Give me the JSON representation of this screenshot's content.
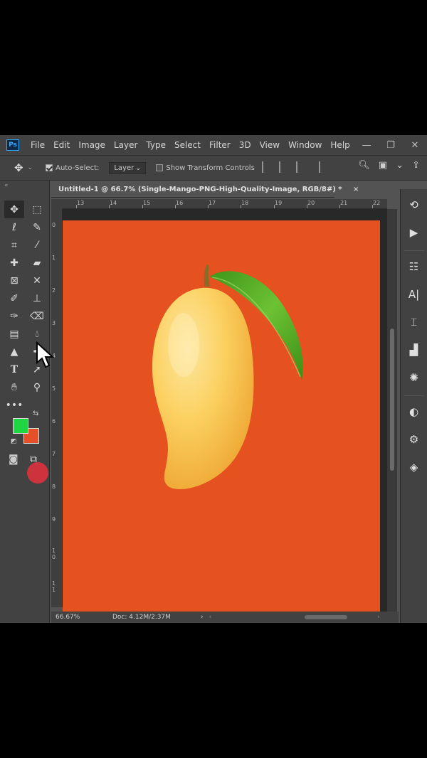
{
  "menu": {
    "logo": "Ps",
    "items": [
      "File",
      "Edit",
      "Image",
      "Layer",
      "Type",
      "Select",
      "Filter",
      "3D",
      "View",
      "Window",
      "Help"
    ],
    "window_controls": [
      "—",
      "❐",
      "✕"
    ]
  },
  "options": {
    "auto_select_label": "Auto-Select:",
    "auto_select_checked": true,
    "layer_dropdown_value": "Layer",
    "show_transform_label": "Show Transform Controls",
    "show_transform_checked": false
  },
  "document_tab": {
    "title": "Untitled-1 @ 66.7% (Single-Mango-PNG-High-Quality-Image, RGB/8#) *",
    "close": "×"
  },
  "rulers": {
    "top": [
      "13",
      "14",
      "15",
      "16",
      "17",
      "18",
      "19",
      "20",
      "21",
      "22"
    ],
    "left": [
      "0",
      "1",
      "2",
      "3",
      "4",
      "5",
      "6",
      "7",
      "8",
      "9",
      "1\n0",
      "1\n1"
    ]
  },
  "status": {
    "zoom": "66.67%",
    "doc_info": "Doc: 4.12M/2.37M",
    "arrow": "›"
  },
  "colors": {
    "canvas_background": "#e5521f",
    "foreground_swatch": "#1ed640",
    "background_swatch": "#e55028",
    "mango_light": "#fbd56a",
    "mango_dark": "#efa830",
    "leaf": "#4aa51f"
  },
  "tools": [
    "move-icon",
    "marquee-icon",
    "lasso-icon",
    "quick-select-icon",
    "crop-icon",
    "eyedropper-icon",
    "healing-icon",
    "brush-icon",
    "frame-icon",
    "content-aware-move-icon",
    "brush-tool-icon",
    "stamp-icon",
    "history-brush-icon",
    "eraser-icon",
    "gradient-icon",
    "blur-icon",
    "dodge-icon",
    "pen-icon",
    "type-icon",
    "path-select-icon",
    "hand-icon",
    "zoom-icon",
    "more-icon"
  ],
  "right_panel_icons": [
    "history-icon",
    "play-icon",
    "properties-icon",
    "character-icon",
    "paths-icon",
    "histogram-icon",
    "navigator-icon",
    "adjustments-icon",
    "libraries-icon",
    "layers-icon"
  ]
}
